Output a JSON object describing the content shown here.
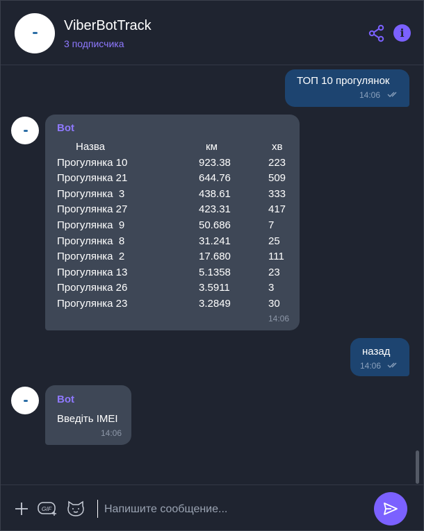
{
  "header": {
    "title": "ViberBotTrack",
    "subtitle": "3 подписчика",
    "share_icon": "share-icon",
    "info_icon": "info-icon",
    "info_glyph": "i"
  },
  "messages": [
    {
      "direction": "out",
      "text": "ТОП 10 прогулянок",
      "time": "14:06"
    },
    {
      "direction": "in",
      "sender": "Bot",
      "table": {
        "headers": [
          "Назва",
          "км",
          "хв"
        ],
        "rows": [
          [
            "Прогулянка 10",
            "923.38",
            "223"
          ],
          [
            "Прогулянка 21",
            "644.76",
            "509"
          ],
          [
            "Прогулянка  3",
            "438.61",
            "333"
          ],
          [
            "Прогулянка 27",
            "423.31",
            "417"
          ],
          [
            "Прогулянка  9",
            "50.686",
            "7"
          ],
          [
            "Прогулянка  8",
            "31.241",
            "25"
          ],
          [
            "Прогулянка  2",
            "17.680",
            "111"
          ],
          [
            "Прогулянка 13",
            "5.1358",
            "23"
          ],
          [
            "Прогулянка 26",
            "3.5911",
            "3"
          ],
          [
            "Прогулянка 23",
            "3.2849",
            "30"
          ]
        ]
      },
      "time": "14:06"
    },
    {
      "direction": "out",
      "text": "назад",
      "time": "14:06"
    },
    {
      "direction": "in",
      "sender": "Bot",
      "text": "Введіть IMEI",
      "time": "14:06"
    }
  ],
  "composer": {
    "placeholder": "Напишите сообщение...",
    "value": "",
    "gif_label": "GIF"
  },
  "colors": {
    "background": "#1f2430",
    "accent": "#7b61ff",
    "outgoing_bubble": "#1d4470",
    "incoming_bubble": "#3e4756",
    "sender_name": "#8f79ff"
  }
}
